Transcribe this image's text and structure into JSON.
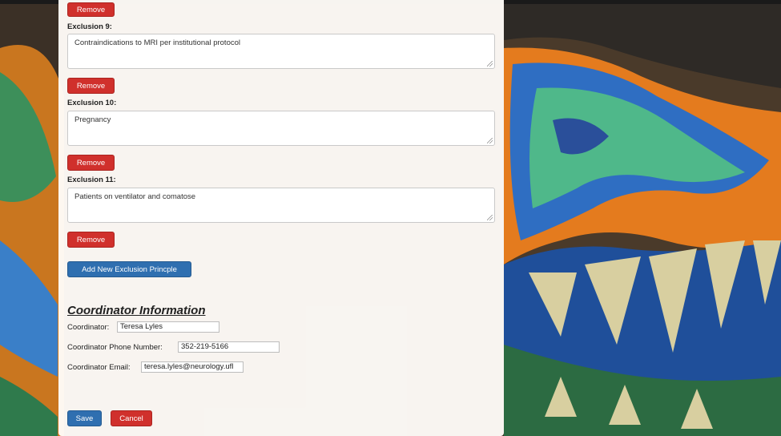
{
  "exclusions": [
    {
      "label": "Exclusion 9:",
      "text": "Contraindications to MRI per institutional protocol",
      "remove_label": "Remove"
    },
    {
      "label": "Exclusion 10:",
      "text": "Pregnancy",
      "remove_label": "Remove"
    },
    {
      "label": "Exclusion 11:",
      "text": "Patients on ventilator and comatose",
      "remove_label": "Remove"
    }
  ],
  "top_remove_label": "Remove",
  "add_exclusion_label": "Add New Exclusion Princple",
  "coordinator": {
    "section_title": "Coordinator Information",
    "name_label": "Coordinator:",
    "name_value": "Teresa Lyles",
    "phone_label": "Coordinator Phone Number:",
    "phone_value": "352-219-5166",
    "email_label": "Coordinator Email:",
    "email_value": "teresa.lyles@neurology.ufl"
  },
  "actions": {
    "save_label": "Save",
    "cancel_label": "Cancel"
  },
  "colors": {
    "danger": "#d0302c",
    "primary": "#2f6fb0"
  }
}
